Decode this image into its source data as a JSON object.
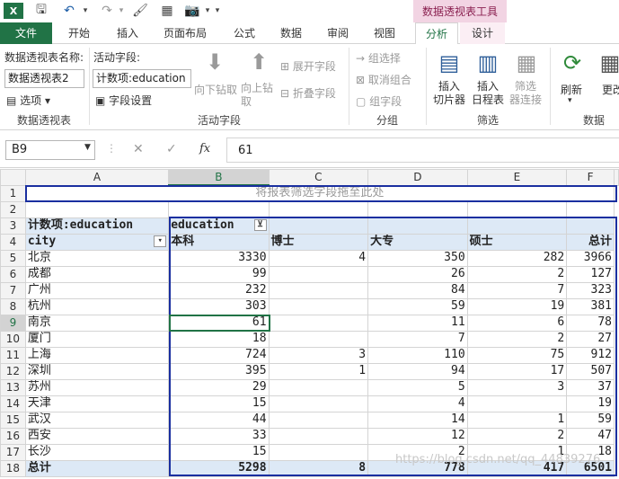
{
  "ribbon_tabs": [
    "文件",
    "开始",
    "插入",
    "页面布局",
    "公式",
    "数据",
    "审阅",
    "视图",
    "分析",
    "设计"
  ],
  "context_tool_title": "数据透视表工具",
  "groups": {
    "pivot": {
      "name_label": "数据透视表名称:",
      "name_value": "数据透视表2",
      "options": "选项",
      "group_label": "数据透视表"
    },
    "active_field": {
      "label": "活动字段:",
      "value": "计数项:education",
      "settings": "字段设置",
      "drill_down": "向下钻取",
      "drill_up": "向上钻取",
      "expand": "展开字段",
      "collapse": "折叠字段",
      "group_label": "活动字段"
    },
    "group": {
      "group_selection": "组选择",
      "ungroup": "取消组合",
      "group_field": "组字段",
      "group_label": "分组"
    },
    "filter": {
      "slicer": "插入\n切片器",
      "timeline": "插入\n日程表",
      "filter_conn": "筛选\n器连接",
      "group_label": "筛选"
    },
    "data": {
      "refresh": "刷新",
      "change_source": "更改",
      "group_label": "数据"
    }
  },
  "formula_bar": {
    "name_box": "B9",
    "value": "61",
    "cancel": "✕",
    "enter": "✓",
    "fx": "fx"
  },
  "columns": [
    "A",
    "B",
    "C",
    "D",
    "E",
    "F"
  ],
  "rows": [
    "1",
    "2",
    "3",
    "4",
    "5",
    "6",
    "7",
    "8",
    "9",
    "10",
    "11",
    "12",
    "13",
    "14",
    "15",
    "16",
    "17",
    "18"
  ],
  "pivot": {
    "drop_hint": "将报表筛选字段拖至此处",
    "count_label": "计数项:education",
    "col_field": "education",
    "row_field": "city",
    "col_headers": [
      "本科",
      "博士",
      "大专",
      "硕士",
      "总计"
    ],
    "data": [
      [
        "北京",
        "3330",
        "4",
        "350",
        "282",
        "3966"
      ],
      [
        "成都",
        "99",
        "",
        "26",
        "2",
        "127"
      ],
      [
        "广州",
        "232",
        "",
        "84",
        "7",
        "323"
      ],
      [
        "杭州",
        "303",
        "",
        "59",
        "19",
        "381"
      ],
      [
        "南京",
        "61",
        "",
        "11",
        "6",
        "78"
      ],
      [
        "厦门",
        "18",
        "",
        "7",
        "2",
        "27"
      ],
      [
        "上海",
        "724",
        "3",
        "110",
        "75",
        "912"
      ],
      [
        "深圳",
        "395",
        "1",
        "94",
        "17",
        "507"
      ],
      [
        "苏州",
        "29",
        "",
        "5",
        "3",
        "37"
      ],
      [
        "天津",
        "15",
        "",
        "4",
        "",
        "19"
      ],
      [
        "武汉",
        "44",
        "",
        "14",
        "1",
        "59"
      ],
      [
        "西安",
        "33",
        "",
        "12",
        "2",
        "47"
      ],
      [
        "长沙",
        "15",
        "",
        "2",
        "1",
        "18"
      ]
    ],
    "total": [
      "总计",
      "5298",
      "8",
      "778",
      "417",
      "6501"
    ]
  },
  "watermark": "https://blog.csdn.net/qq_44839276",
  "colors": {
    "accent": "#217346",
    "pivot_border": "#1a2fa0",
    "header_fill": "#dde9f6",
    "context_tab": "#f2d4e3"
  }
}
